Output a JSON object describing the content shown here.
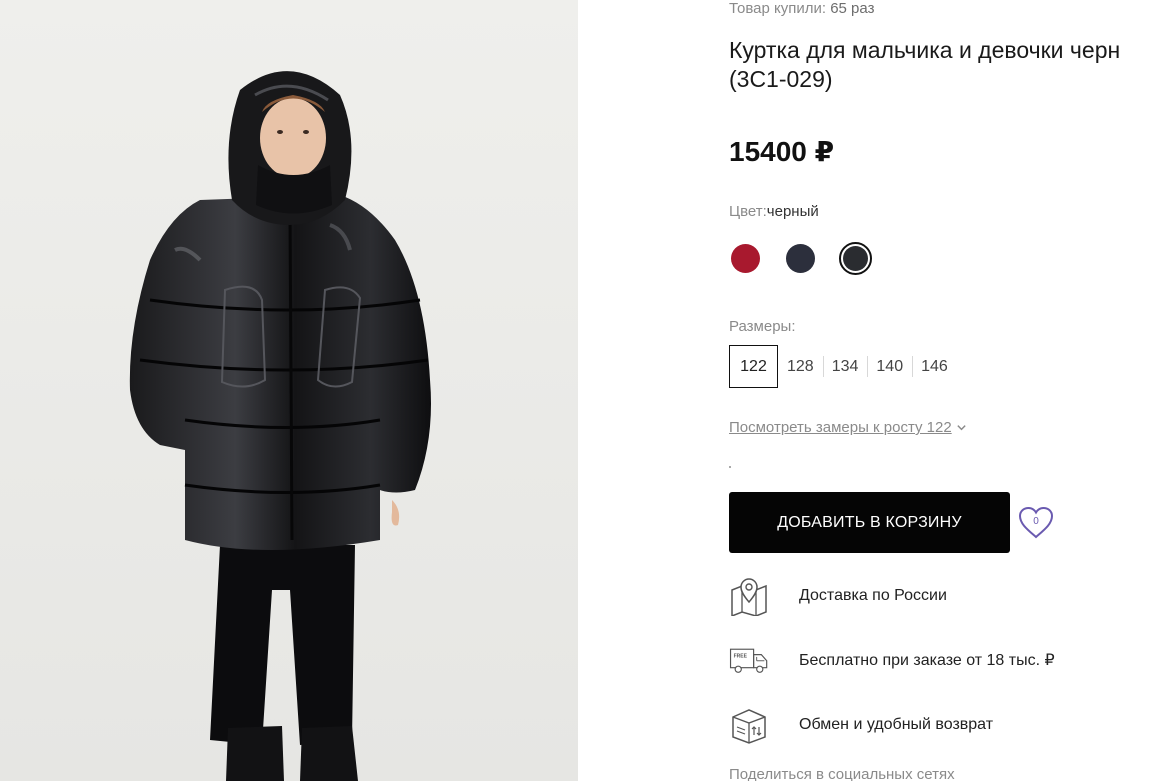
{
  "product": {
    "bought_label": "Товар купили:",
    "bought_count": "65 раз",
    "title_line1": "Куртка для мальчика и девочки черн",
    "title_line2": "(3С1-029)",
    "price": "15400 ₽",
    "image_alt": "Куртка для мальчика и девочки черная"
  },
  "color": {
    "label": "Цвет:",
    "value": "черный",
    "swatches": [
      {
        "name": "red",
        "hex": "#a8192e",
        "selected": false
      },
      {
        "name": "navy",
        "hex": "#2c2f3c",
        "selected": false
      },
      {
        "name": "black",
        "hex": "#2a2c30",
        "selected": true
      }
    ]
  },
  "sizes": {
    "label": "Размеры:",
    "items": [
      "122",
      "128",
      "134",
      "140",
      "146"
    ],
    "selected": "122"
  },
  "measure_link": "Посмотреть замеры к росту 122",
  "cart_button": "ДОБАВИТЬ В КОРЗИНУ",
  "favorites_count": "0",
  "perks": [
    {
      "icon": "map-location-icon",
      "text": "Доставка по России"
    },
    {
      "icon": "free-delivery-truck-icon",
      "text": "Бесплатно при заказе от 18 тыс. ₽"
    },
    {
      "icon": "return-box-icon",
      "text": "Обмен и удобный возврат"
    }
  ],
  "share_label": "Поделиться в социальных сетях",
  "colors": {
    "button_bg": "#050505",
    "accent_heart": "#6a5ab0",
    "muted_text": "#8a8a8a"
  }
}
